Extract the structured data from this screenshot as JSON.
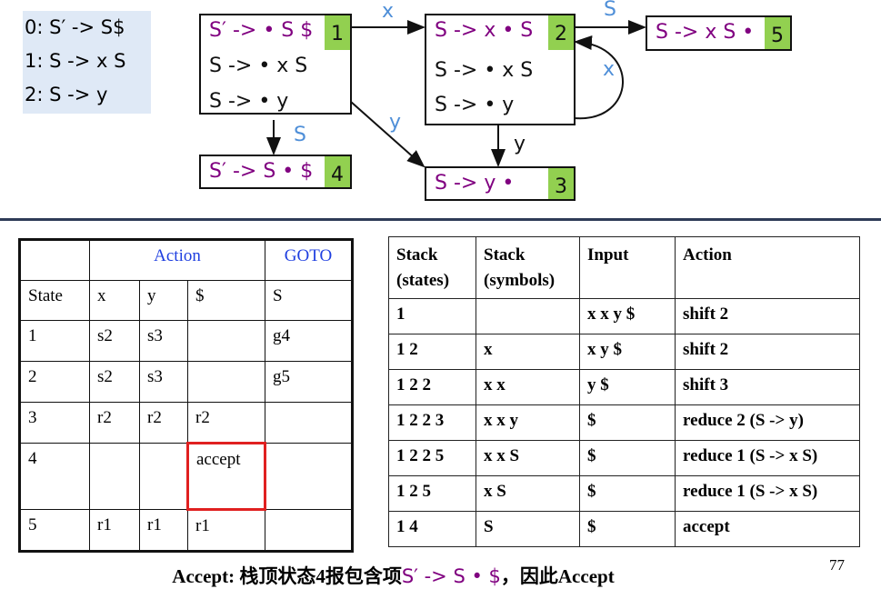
{
  "grammar": [
    "0: S′ -> S$",
    "1: S -> x S",
    "2: S -> y"
  ],
  "states": {
    "s1": {
      "num": "1",
      "items": [
        "S′ -> • S $",
        "S -> • x S",
        "S -> • y"
      ]
    },
    "s2": {
      "num": "2",
      "items": [
        "S -> x • S",
        "S -> • x S",
        "S -> • y"
      ]
    },
    "s3": {
      "num": "3",
      "items": [
        "S -> y •"
      ]
    },
    "s4": {
      "num": "4",
      "items": [
        "S′ -> S • $"
      ]
    },
    "s5": {
      "num": "5",
      "items": [
        "S -> x S •"
      ]
    }
  },
  "edges": {
    "e12": "x",
    "e25": "S",
    "e22": "x",
    "e14": "S",
    "e13": "y",
    "e23": "y"
  },
  "action_table": {
    "header": {
      "action": "Action",
      "goto": "GOTO"
    },
    "columns": [
      "State",
      "x",
      "y",
      "$",
      "S"
    ],
    "rows": [
      [
        "1",
        "s2",
        "s3",
        "",
        "g4"
      ],
      [
        "2",
        "s2",
        "s3",
        "",
        "g5"
      ],
      [
        "3",
        "r2",
        "r2",
        "r2",
        ""
      ],
      [
        "4",
        "",
        "",
        "accept",
        ""
      ],
      [
        "5",
        "r1",
        "r1",
        "r1",
        ""
      ]
    ],
    "highlight_color": "#e02020"
  },
  "trace_table": {
    "columns": [
      "Stack\n(states)",
      "Stack\n(symbols)",
      "Input",
      "Action"
    ],
    "rows": [
      [
        "1",
        "",
        "x x y $",
        "shift 2"
      ],
      [
        "1 2",
        "x",
        "x y $",
        "shift 2"
      ],
      [
        "1 2 2",
        "x x",
        "y $",
        "shift 3"
      ],
      [
        "1 2 2 3",
        "x x y",
        "$",
        "reduce 2 (S -> y)"
      ],
      [
        "1 2 2 5",
        "x x S",
        "$",
        "reduce 1 (S -> x S)"
      ],
      [
        "1 2 5",
        "x S",
        "$",
        "reduce 1 (S -> x S)"
      ],
      [
        "1 4",
        "S",
        "$",
        "accept"
      ]
    ]
  },
  "footer": {
    "prefix": "Accept: 栈顶状态4报包含项",
    "item": "S′ -> S • $",
    "suffix": "，因此Accept"
  },
  "page_number": "77"
}
